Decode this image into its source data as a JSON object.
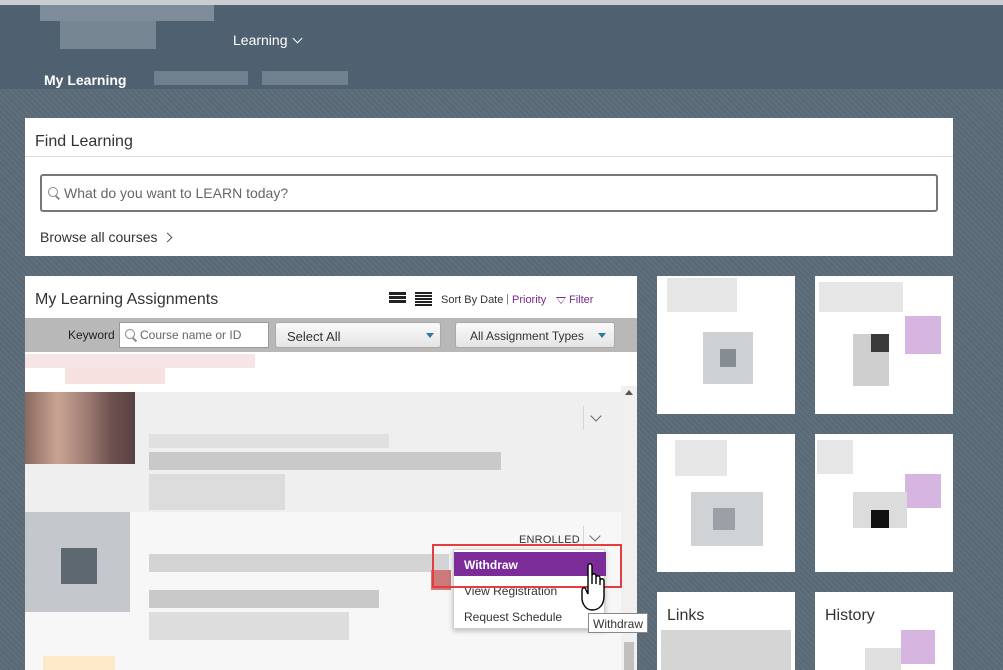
{
  "header": {
    "nav_learning": "Learning",
    "subnav_current": "My Learning"
  },
  "find_learning": {
    "title": "Find Learning",
    "search_placeholder": "What do you want to LEARN today?",
    "browse_label": "Browse all courses"
  },
  "assignments": {
    "title": "My Learning Assignments",
    "sort_by": "Sort By Date",
    "sort_separator": "|",
    "sort_priority": "Priority",
    "filter_label": "Filter",
    "keyword_label": "Keyword",
    "keyword_placeholder": "Course name or ID",
    "select_all": "Select All",
    "assignment_types": "All Assignment Types",
    "status_enrolled": "ENROLLED"
  },
  "context_menu": {
    "items": [
      "Withdraw",
      "View Registration",
      "Request Schedule"
    ],
    "active_index": 0
  },
  "tooltip": "Withdraw",
  "tiles": {
    "links": "Links",
    "history": "History"
  },
  "colors": {
    "header_bg": "#4f6170",
    "accent_purple": "#7b2c99",
    "link_purple": "#7a2a8c",
    "highlight_red": "#e53d3d"
  }
}
